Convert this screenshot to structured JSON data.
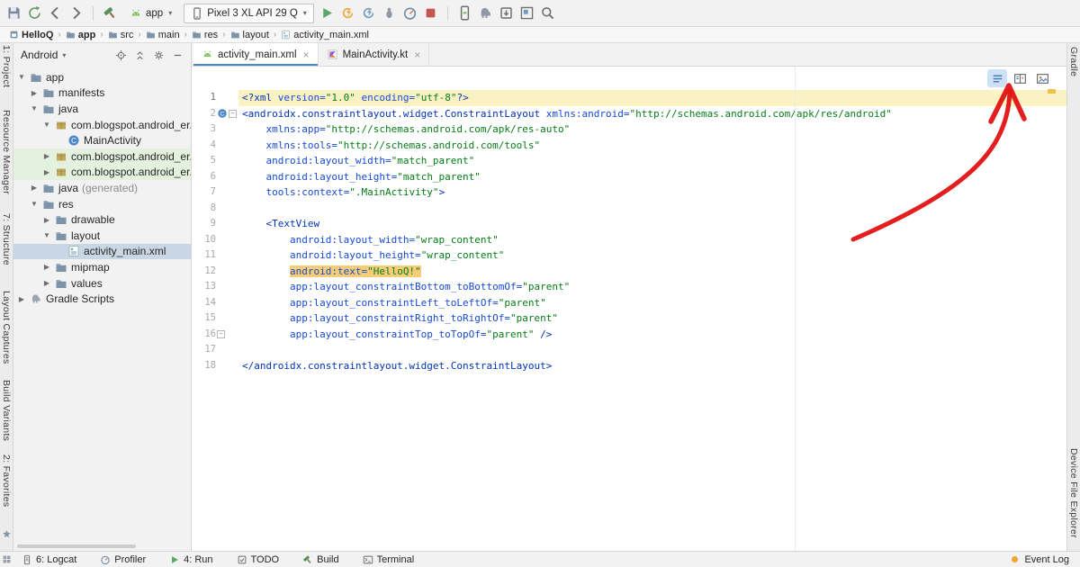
{
  "toolbar": {
    "left_icons": [
      "save",
      "sync",
      "back",
      "forward"
    ],
    "build_icon": "hammer",
    "run_config": "app",
    "device": "Pixel 3 XL API 29 Q",
    "run_icons": [
      "run",
      "apply-changes",
      "apply-code-changes",
      "attach-debugger",
      "profile",
      "stop"
    ],
    "tool_icons": [
      "avd-manager",
      "sync-gradle",
      "sdk-manager",
      "layout-inspector",
      "search"
    ]
  },
  "breadcrumbs": {
    "items": [
      {
        "label": "HelloQ",
        "icon": "project"
      },
      {
        "label": "app",
        "icon": "folder"
      },
      {
        "label": "src",
        "icon": "folder"
      },
      {
        "label": "main",
        "icon": "folder"
      },
      {
        "label": "res",
        "icon": "folder"
      },
      {
        "label": "layout",
        "icon": "folder"
      },
      {
        "label": "activity_main.xml",
        "icon": "xml-file"
      }
    ]
  },
  "left_stripe": {
    "items": [
      "1: Project",
      "Resource Manager",
      "7: Structure",
      "Layout Captures",
      "Build Variants",
      "2: Favorites"
    ]
  },
  "right_stripe": {
    "items": [
      "Gradle",
      "Device File Explorer"
    ]
  },
  "project_panel": {
    "view_mode": "Android",
    "header_icons": [
      "locate",
      "collapse-all",
      "gear",
      "hide"
    ],
    "tree": [
      {
        "label": "app",
        "indent": 0,
        "arrow": "expanded",
        "icon": "folder"
      },
      {
        "label": "manifests",
        "indent": 1,
        "arrow": "collapsed",
        "icon": "folder"
      },
      {
        "label": "java",
        "indent": 1,
        "arrow": "expanded",
        "icon": "folder"
      },
      {
        "label": "com.blogspot.android_er.h",
        "indent": 2,
        "arrow": "expanded",
        "icon": "package"
      },
      {
        "label": "MainActivity",
        "indent": 3,
        "arrow": "none",
        "icon": "class"
      },
      {
        "label": "com.blogspot.android_er.h",
        "indent": 2,
        "arrow": "collapsed",
        "icon": "package",
        "green": true
      },
      {
        "label": "com.blogspot.android_er.h",
        "indent": 2,
        "arrow": "collapsed",
        "icon": "package",
        "green": true
      },
      {
        "label": "java",
        "suffix": " (generated)",
        "indent": 1,
        "arrow": "collapsed",
        "icon": "folder"
      },
      {
        "label": "res",
        "indent": 1,
        "arrow": "expanded",
        "icon": "folder"
      },
      {
        "label": "drawable",
        "indent": 2,
        "arrow": "collapsed",
        "icon": "folder"
      },
      {
        "label": "layout",
        "indent": 2,
        "arrow": "expanded",
        "icon": "folder"
      },
      {
        "label": "activity_main.xml",
        "indent": 3,
        "arrow": "none",
        "icon": "xml-file",
        "selected": true
      },
      {
        "label": "mipmap",
        "indent": 2,
        "arrow": "collapsed",
        "icon": "folder"
      },
      {
        "label": "values",
        "indent": 2,
        "arrow": "collapsed",
        "icon": "folder"
      },
      {
        "label": "Gradle Scripts",
        "indent": 0,
        "arrow": "collapsed",
        "icon": "gradle"
      }
    ]
  },
  "tabs": [
    {
      "label": "activity_main.xml",
      "icon": "android-head",
      "selected": true
    },
    {
      "label": "MainActivity.kt",
      "icon": "kotlin",
      "selected": false
    }
  ],
  "view_modes": [
    {
      "id": "code",
      "icon": "code-view",
      "selected": true
    },
    {
      "id": "split",
      "icon": "split-view",
      "selected": false
    },
    {
      "id": "design",
      "icon": "design-view",
      "selected": false
    }
  ],
  "editor": {
    "lines": [
      {
        "num": "1",
        "caret": true,
        "s": [
          {
            "t": "<?xml ",
            "c": "tag"
          },
          {
            "t": "version=",
            "c": "attr"
          },
          {
            "t": "\"1.0\"",
            "c": "str"
          },
          {
            "t": " ",
            "c": "pl"
          },
          {
            "t": "encoding=",
            "c": "attr"
          },
          {
            "t": "\"utf-8\"",
            "c": "str"
          },
          {
            "t": "?>",
            "c": "tag"
          }
        ]
      },
      {
        "num": "2",
        "gutter_icon": "class",
        "fold": true,
        "s": [
          {
            "t": "<androidx.constraintlayout.widget.ConstraintLayout ",
            "c": "tag"
          },
          {
            "t": "xmlns:android=",
            "c": "attr"
          },
          {
            "t": "\"http://schemas.android.com/apk/res/android\"",
            "c": "str"
          }
        ]
      },
      {
        "num": "3",
        "s": [
          {
            "t": "    ",
            "c": "pl"
          },
          {
            "t": "xmlns:app=",
            "c": "attr"
          },
          {
            "t": "\"http://schemas.android.com/apk/res-auto\"",
            "c": "str"
          }
        ]
      },
      {
        "num": "4",
        "s": [
          {
            "t": "    ",
            "c": "pl"
          },
          {
            "t": "xmlns:tools=",
            "c": "attr"
          },
          {
            "t": "\"http://schemas.android.com/tools\"",
            "c": "str"
          }
        ]
      },
      {
        "num": "5",
        "s": [
          {
            "t": "    ",
            "c": "pl"
          },
          {
            "t": "android:layout_width=",
            "c": "attr"
          },
          {
            "t": "\"match_parent\"",
            "c": "str"
          }
        ]
      },
      {
        "num": "6",
        "s": [
          {
            "t": "    ",
            "c": "pl"
          },
          {
            "t": "android:layout_height=",
            "c": "attr"
          },
          {
            "t": "\"match_parent\"",
            "c": "str"
          }
        ]
      },
      {
        "num": "7",
        "s": [
          {
            "t": "    ",
            "c": "pl"
          },
          {
            "t": "tools:context=",
            "c": "attr"
          },
          {
            "t": "\".MainActivity\"",
            "c": "str"
          },
          {
            "t": ">",
            "c": "tag"
          }
        ]
      },
      {
        "num": "8",
        "s": []
      },
      {
        "num": "9",
        "s": [
          {
            "t": "    ",
            "c": "pl"
          },
          {
            "t": "<TextView",
            "c": "tag"
          }
        ]
      },
      {
        "num": "10",
        "s": [
          {
            "t": "        ",
            "c": "pl"
          },
          {
            "t": "android:layout_width=",
            "c": "attr"
          },
          {
            "t": "\"wrap_content\"",
            "c": "str"
          }
        ]
      },
      {
        "num": "11",
        "s": [
          {
            "t": "        ",
            "c": "pl"
          },
          {
            "t": "android:layout_height=",
            "c": "attr"
          },
          {
            "t": "\"wrap_content\"",
            "c": "str"
          }
        ]
      },
      {
        "num": "12",
        "s": [
          {
            "t": "        ",
            "c": "pl"
          },
          {
            "t": "android:text=",
            "c": "attr",
            "h": true
          },
          {
            "t": "\"HelloQ!\"",
            "c": "str",
            "h": true
          }
        ]
      },
      {
        "num": "13",
        "s": [
          {
            "t": "        ",
            "c": "pl"
          },
          {
            "t": "app:layout_constraintBottom_toBottomOf=",
            "c": "attr"
          },
          {
            "t": "\"parent\"",
            "c": "str"
          }
        ]
      },
      {
        "num": "14",
        "s": [
          {
            "t": "        ",
            "c": "pl"
          },
          {
            "t": "app:layout_constraintLeft_toLeftOf=",
            "c": "attr"
          },
          {
            "t": "\"parent\"",
            "c": "str"
          }
        ]
      },
      {
        "num": "15",
        "s": [
          {
            "t": "        ",
            "c": "pl"
          },
          {
            "t": "app:layout_constraintRight_toRightOf=",
            "c": "attr"
          },
          {
            "t": "\"parent\"",
            "c": "str"
          }
        ]
      },
      {
        "num": "16",
        "fold": true,
        "s": [
          {
            "t": "        ",
            "c": "pl"
          },
          {
            "t": "app:layout_constraintTop_toTopOf=",
            "c": "attr"
          },
          {
            "t": "\"parent\"",
            "c": "str"
          },
          {
            "t": " />",
            "c": "tag"
          }
        ]
      },
      {
        "num": "17",
        "s": []
      },
      {
        "num": "18",
        "s": [
          {
            "t": "</androidx.constraintlayout.widget.ConstraintLayout>",
            "c": "tag"
          }
        ]
      }
    ]
  },
  "status_bar": {
    "items": [
      {
        "label": "6: Logcat",
        "icon": "logcat"
      },
      {
        "label": "Profiler",
        "icon": "profiler"
      },
      {
        "label": "4: Run",
        "icon": "run"
      },
      {
        "label": "TODO",
        "icon": "todo"
      },
      {
        "label": "Build",
        "icon": "hammer"
      },
      {
        "label": "Terminal",
        "icon": "terminal"
      }
    ],
    "right": {
      "label": "Event Log",
      "icon": "balloon"
    }
  },
  "annotation": {
    "color": "#e01212"
  }
}
